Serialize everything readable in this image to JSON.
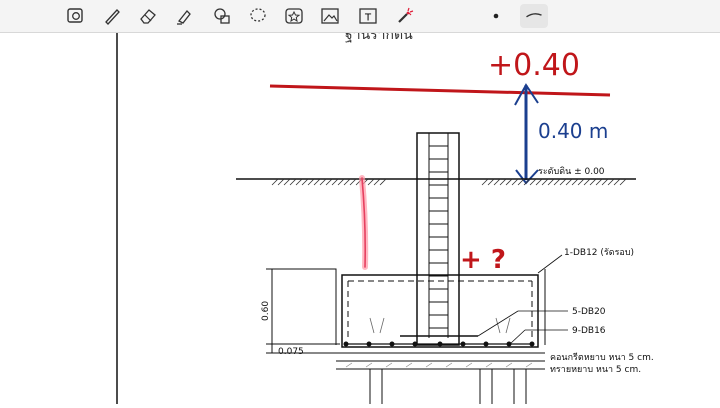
{
  "toolbar": {
    "tools": [
      {
        "name": "lasso-select",
        "label": ""
      },
      {
        "name": "pen",
        "label": ""
      },
      {
        "name": "eraser",
        "label": ""
      },
      {
        "name": "highlighter",
        "label": ""
      },
      {
        "name": "shapes",
        "label": ""
      },
      {
        "name": "lasso",
        "label": ""
      },
      {
        "name": "sticker",
        "label": ""
      },
      {
        "name": "image",
        "label": ""
      },
      {
        "name": "text-box",
        "label": "T"
      },
      {
        "name": "laser-pointer",
        "label": ""
      },
      {
        "name": "color-dot",
        "label": "•"
      },
      {
        "name": "stroke-preview",
        "label": ""
      }
    ]
  },
  "drawing": {
    "handwritten_level": "+0.40",
    "handwritten_height": "0.40 m",
    "ground_label": "ระดับดิน ± 0.00",
    "rebar_ring": "1-DB12 (รัดรอบ)",
    "rebar_top": "5-DB20",
    "rebar_bottom": "9-DB16",
    "dim_height": "0.60",
    "dim_cover": "0.075",
    "concrete_note": "คอนกรีตหยาบ หนา 5 cm.",
    "sand_note": "ทรายหยาบ หนา 5 cm.",
    "red_question": "+ ?"
  },
  "colors": {
    "ink_red": "#c0161a",
    "ink_blue": "#1b3f8f",
    "pink": "#e64060",
    "line": "#111111"
  }
}
